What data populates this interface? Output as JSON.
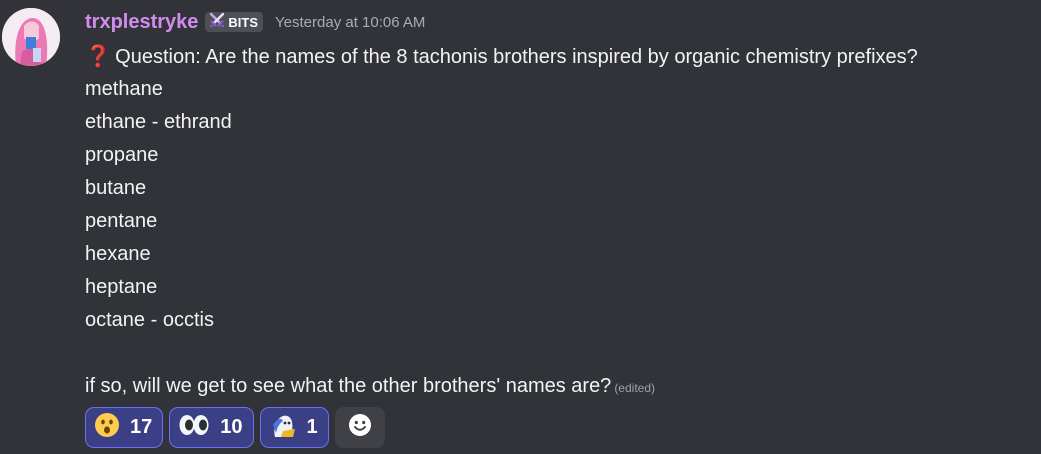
{
  "message": {
    "author": "trxplestryke",
    "role_tag": "BITS",
    "role_tag_icon": "crossed-swords-icon",
    "timestamp": "Yesterday at 10:06 AM",
    "question_icon": "❓",
    "lines": [
      "Question: Are the names of the 8 tachonis brothers inspired by organic chemistry prefixes?",
      "methane",
      "ethane - ethrand",
      "propane",
      "butane",
      "pentane",
      "hexane",
      "heptane",
      "octane - occtis",
      "",
      "if so, will we get to see what the other brothers' names are?"
    ],
    "edited_label": "(edited)"
  },
  "reactions": [
    {
      "emoji": "astonished-face-icon",
      "count": "17"
    },
    {
      "emoji": "eyes-icon",
      "count": "10"
    },
    {
      "emoji": "custom-character-icon",
      "count": "1"
    }
  ],
  "add_reaction": {
    "icon": "smiley-add-reaction-icon"
  },
  "colors": {
    "background": "#313338",
    "username": "#d28cf0",
    "reaction_bg": "#3b3f86",
    "reaction_border": "#6b6ff2"
  }
}
